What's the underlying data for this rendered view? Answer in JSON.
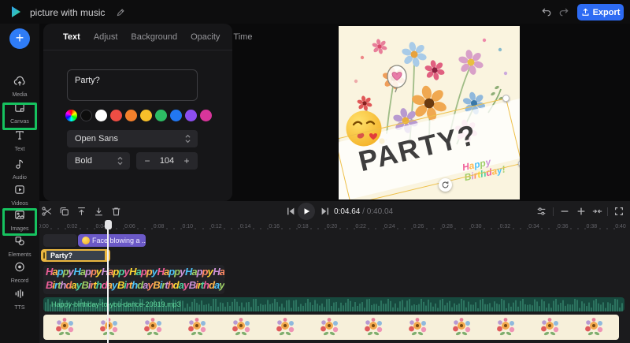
{
  "colors": {
    "accent_blue": "#2d6bf3",
    "highlight_green": "#16c25f",
    "purple_clip": "#6b59c7",
    "selection_yellow": "#eab640",
    "audio_clip_green": "#17493e",
    "audio_text_green": "#62dc9e",
    "letter_palette": [
      "#f0609a",
      "#ffb74d",
      "#4fc3f7",
      "#9ccc65",
      "#ce93d8",
      "#ff8a65",
      "#fdd835",
      "#4dd0a1"
    ]
  },
  "topbar": {
    "title": "picture with music",
    "export_label": "Export"
  },
  "sidebar": {
    "items": [
      {
        "label": "Media"
      },
      {
        "label": "Canvas"
      },
      {
        "label": "Text"
      },
      {
        "label": "Audio"
      },
      {
        "label": "Videos"
      },
      {
        "label": "Images"
      },
      {
        "label": "Elements"
      },
      {
        "label": "Record"
      },
      {
        "label": "TTS"
      }
    ]
  },
  "panel": {
    "tabs": [
      "Text",
      "Adjust",
      "Background",
      "Opacity",
      "Time"
    ],
    "active_tab": "Text",
    "text_value": "Party?",
    "swatches": [
      "wheel",
      "#0d0d0d",
      "#ffffff",
      "#ee4d44",
      "#f4802c",
      "#f7bf2a",
      "#2dbd64",
      "#2277f2",
      "#8c4ef0",
      "#d8359b"
    ],
    "font": "Open Sans",
    "style": "Bold",
    "size": "104",
    "minus": "−",
    "plus": "+"
  },
  "preview": {
    "party_text": "PARTY?",
    "happy_line1": "Happy",
    "happy_line2": "Birthday!"
  },
  "timeline": {
    "current_time": "0:04.64",
    "time_separator": " / ",
    "total_time": "0:40.04",
    "ruler_labels": [
      "0:00",
      "0:02",
      "0:04",
      "0:06",
      "0:08",
      "0:10",
      "0:12",
      "0:14",
      "0:16",
      "0:18",
      "0:20",
      "0:22",
      "0:24",
      "0:26",
      "0:28",
      "0:30",
      "0:32",
      "0:34",
      "0:36",
      "0:38",
      "0:40"
    ],
    "clips": {
      "face_label": "Face blowing a ...",
      "party_label": "Party?",
      "audio_label": "Happy-birthday-to-you-dance-20919.mp3",
      "happy_word1": "Happy",
      "happy_word2": "Birthday"
    }
  }
}
